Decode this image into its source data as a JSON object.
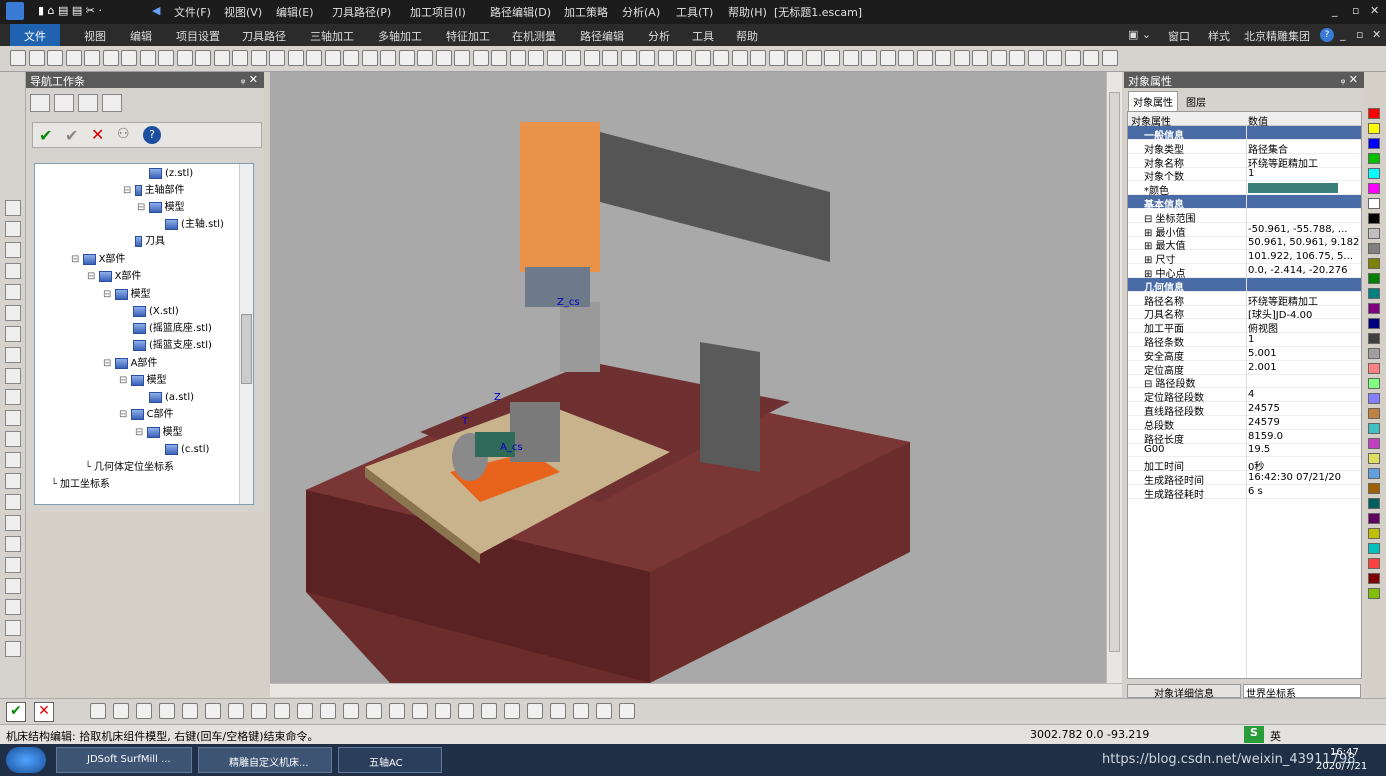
{
  "titlebar": {
    "menus": [
      "文件(F)",
      "视图(V)",
      "编辑(E)",
      "刀具路径(P)",
      "加工项目(I)",
      "路径编辑(D)",
      "加工策略",
      "分析(A)",
      "工具(T)",
      "帮助(H)"
    ],
    "doc": "[无标题1.escam]",
    "controls": [
      "_",
      "▫",
      "✕"
    ]
  },
  "ribbon": {
    "active": "文件",
    "tabs": [
      "视图",
      "编辑",
      "项目设置",
      "刀具路径",
      "三轴加工",
      "多轴加工",
      "特征加工",
      "在机测量",
      "路径编辑",
      "分析",
      "工具",
      "帮助"
    ],
    "right": {
      "window": "窗口",
      "style": "样式",
      "company": "北京精雕集团",
      "help": "?",
      "controls": [
        "_",
        "▫",
        "✕"
      ]
    }
  },
  "nav": {
    "title": "导航工作条",
    "pin": "ᵩ ✕",
    "tree": [
      {
        "t": "(z.stl)",
        "icon": "model"
      },
      {
        "t": "主轴部件",
        "icon": "spindle"
      },
      {
        "t": "模型",
        "icon": "model"
      },
      {
        "t": "(主轴.stl)",
        "icon": "model"
      },
      {
        "t": "刀具",
        "icon": "tool"
      },
      {
        "t": "X部件",
        "icon": "axis"
      },
      {
        "t": "X部件",
        "icon": "axis"
      },
      {
        "t": "模型",
        "icon": "model"
      },
      {
        "t": "(X.stl)",
        "icon": "model"
      },
      {
        "t": "(摇篮底座.stl)",
        "icon": "model"
      },
      {
        "t": "(摇篮支座.stl)",
        "icon": "model"
      },
      {
        "t": "A部件",
        "icon": "axis"
      },
      {
        "t": "模型",
        "icon": "model"
      },
      {
        "t": "(a.stl)",
        "icon": "model"
      },
      {
        "t": "C部件",
        "icon": "axis"
      },
      {
        "t": "模型",
        "icon": "model"
      },
      {
        "t": "(c.stl)",
        "icon": "model"
      },
      {
        "t": "几何体定位坐标系",
        "icon": "cs"
      },
      {
        "t": "加工坐标系",
        "icon": "cs"
      }
    ]
  },
  "viewport": {
    "labels": {
      "z_cs": "Z_cs",
      "z": "Z",
      "t": "T",
      "a_cs": "A_cs"
    }
  },
  "props": {
    "title": "对象属性",
    "pin": "ᵩ ✕",
    "tabs": [
      "对象属性",
      "图层"
    ],
    "col_key": "对象属性",
    "col_val": "数值",
    "rows": [
      {
        "k": "一般信息",
        "v": "",
        "sec": true
      },
      {
        "k": "对象类型",
        "v": "路径集合"
      },
      {
        "k": "对象名称",
        "v": "环绕等距精加工"
      },
      {
        "k": "对象个数",
        "v": "1"
      },
      {
        "k": "*颜色",
        "v": ""
      },
      {
        "k": "基本信息",
        "v": "",
        "sec": true
      },
      {
        "k": "⊟ 坐标范围",
        "v": ""
      },
      {
        "k": "⊞ 最小值",
        "v": "-50.961, -55.788, ..."
      },
      {
        "k": "⊞ 最大值",
        "v": "50.961, 50.961, 9.182"
      },
      {
        "k": "⊞ 尺寸",
        "v": "101.922, 106.75, 5..."
      },
      {
        "k": "⊞ 中心点",
        "v": "0.0, -2.414, -20.276"
      },
      {
        "k": "几何信息",
        "v": "",
        "sec": true
      },
      {
        "k": "路径名称",
        "v": "环绕等距精加工"
      },
      {
        "k": "刀具名称",
        "v": "[球头]JD-4.00"
      },
      {
        "k": "加工平面",
        "v": "俯视图"
      },
      {
        "k": "路径条数",
        "v": "1"
      },
      {
        "k": "安全高度",
        "v": "5.001"
      },
      {
        "k": "定位高度",
        "v": "2.001"
      },
      {
        "k": "⊟ 路径段数",
        "v": ""
      },
      {
        "k": "定位路径段数",
        "v": "4"
      },
      {
        "k": "直线路径段数",
        "v": "24575"
      },
      {
        "k": "总段数",
        "v": "24579"
      },
      {
        "k": "路径长度",
        "v": "8159.0"
      },
      {
        "k": "G00",
        "v": "19.5"
      },
      {
        "k": "加工时间",
        "v": "0秒"
      },
      {
        "k": "生成路径时间",
        "v": "16:42:30 07/21/20"
      },
      {
        "k": "生成路径耗时",
        "v": "6 s"
      }
    ],
    "footer_left": "对象详细信息",
    "footer_right": "世界坐标系"
  },
  "colors": [
    "#ff0000",
    "#ffff00",
    "#0000ff",
    "#00c000",
    "#00ffff",
    "#ff00ff",
    "#ffffff",
    "#000000",
    "#c0c0c0",
    "#808080",
    "#808000",
    "#008000",
    "#008080",
    "#800080",
    "#000080",
    "#404040",
    "#a0a0a0",
    "#ff8080",
    "#80ff80",
    "#8080ff",
    "#c08040",
    "#40c0c0",
    "#c040c0",
    "#e0e060",
    "#60a0e0",
    "#a06000",
    "#006060",
    "#600060",
    "#c0c000",
    "#00c0c0",
    "#ff4040",
    "#800000",
    "#80c000"
  ],
  "status": {
    "text": "机床结构编辑: 拾取机床组件模型, 右键(回车/空格键)结束命令。",
    "coords": "3002.782 0.0 -93.219",
    "watermark": "https://blog.csdn.net/weixin_43911798",
    "ime": "英",
    "time": "16:47",
    "date": "2020/7/21"
  },
  "taskbar": {
    "items": [
      "JDSoft SurfMill ...",
      "精雕自定义机床...",
      "五轴AC"
    ]
  }
}
